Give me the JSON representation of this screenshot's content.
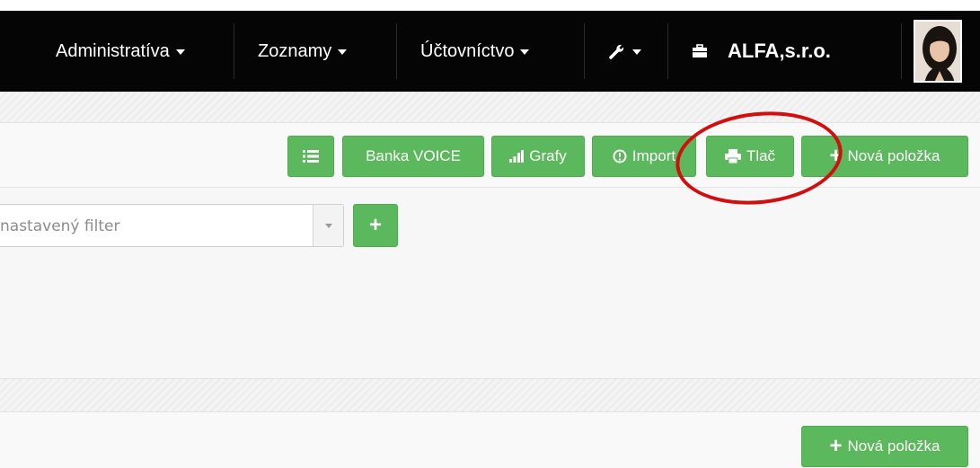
{
  "navbar": {
    "administrativa": "Administratíva",
    "zoznamy": "Zoznamy",
    "uctovnictvo": "Účtovníctvo",
    "company": "ALFA,s.r.o."
  },
  "toolbar": {
    "banka_label": "Banka VOICE",
    "grafy_label": "Grafy",
    "import_label": "Import",
    "tlac_label": "Tlač",
    "nova_label": "Nová položka"
  },
  "filter": {
    "placeholder": "nastavený filter"
  },
  "bottom": {
    "nova_label": "Nová položka"
  },
  "colors": {
    "navbar_bg": "#050505",
    "button_green": "#5cb85c",
    "highlight_red": "#d20f0f"
  },
  "icons": {
    "list": "list-icon",
    "grafy": "bar-chart-icon",
    "import": "info-circle-icon",
    "tlac": "printer-icon",
    "plus": "plus-icon",
    "wrench": "wrench-icon",
    "briefcase": "briefcase-icon"
  }
}
